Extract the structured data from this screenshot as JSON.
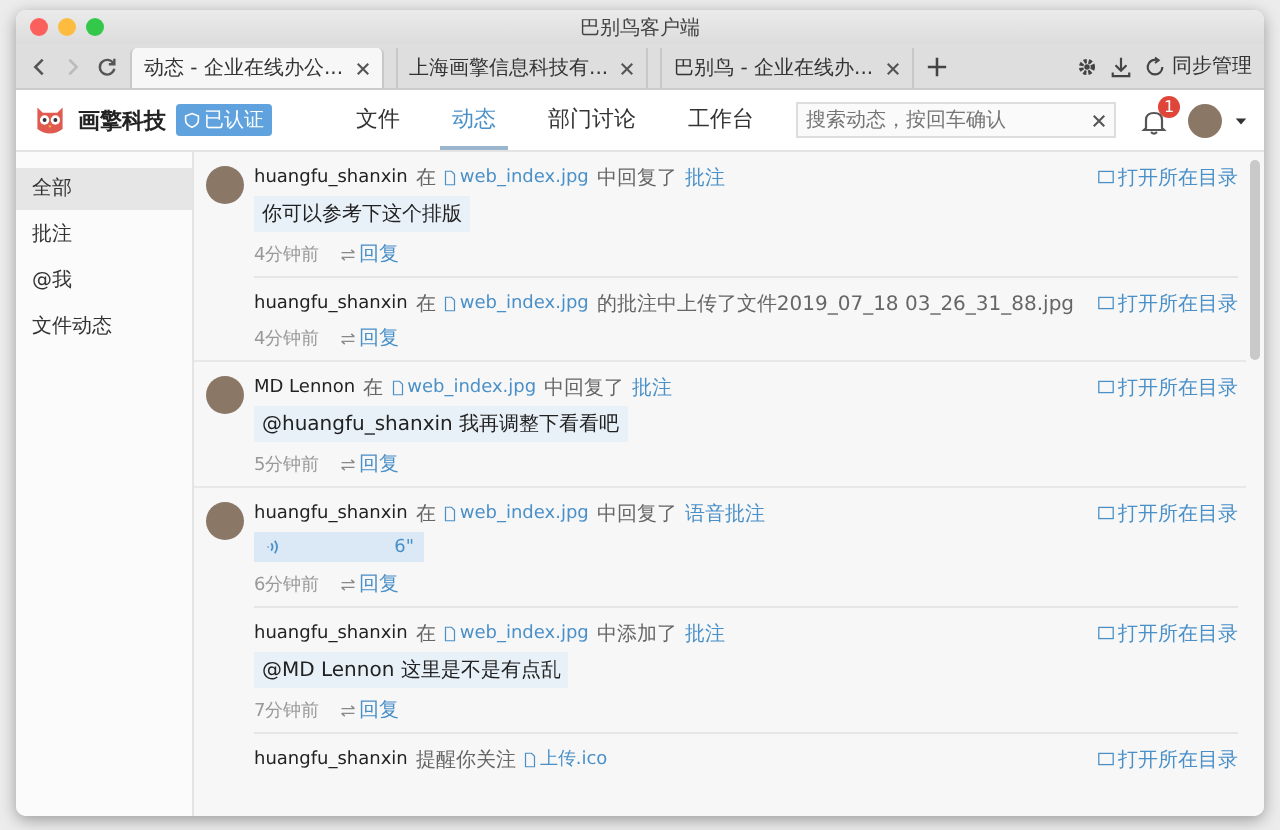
{
  "window": {
    "title": "巴别鸟客户端"
  },
  "browser_tabs": [
    {
      "label": "动态 - 企业在线办公...",
      "selected": true
    },
    {
      "label": "上海画擎信息科技有...",
      "selected": false
    },
    {
      "label": "巴别鸟 - 企业在线办...",
      "selected": false
    }
  ],
  "toolbar": {
    "sync_label": "同步管理"
  },
  "header": {
    "brand": "画擎科技",
    "badge": "已认证",
    "nav": [
      {
        "label": "文件",
        "selected": false
      },
      {
        "label": "动态",
        "selected": true
      },
      {
        "label": "部门讨论",
        "selected": false
      },
      {
        "label": "工作台",
        "selected": false
      }
    ],
    "search": {
      "placeholder": "搜索动态，按回车确认"
    },
    "notification_count": "1"
  },
  "sidebar": {
    "items": [
      {
        "label": "全部",
        "selected": true
      },
      {
        "label": "批注",
        "selected": false
      },
      {
        "label": "@我",
        "selected": false
      },
      {
        "label": "文件动态",
        "selected": false
      }
    ]
  },
  "feed": [
    {
      "kind": "comment",
      "avatar": true,
      "user": "huangfu_shanxin",
      "at": "在",
      "file": "web_index.jpg",
      "action": "中回复了",
      "target": "批注",
      "body": "你可以参考下这个排版",
      "time": "4分钟前",
      "reply": "回复",
      "open_dir": "打开所在目录"
    },
    {
      "kind": "upload",
      "avatar": false,
      "user": "huangfu_shanxin",
      "at": "在",
      "file": "web_index.jpg",
      "action": "的批注中上传了文件2019_07_18 03_26_31_88.jpg",
      "time": "4分钟前",
      "reply": "回复",
      "open_dir": "打开所在目录"
    },
    {
      "kind": "comment",
      "avatar": true,
      "user": "MD Lennon",
      "at": "在",
      "file": "web_index.jpg",
      "action": "中回复了",
      "target": "批注",
      "body": "@huangfu_shanxin 我再调整下看看吧",
      "time": "5分钟前",
      "reply": "回复",
      "open_dir": "打开所在目录"
    },
    {
      "kind": "voice",
      "avatar": true,
      "user": "huangfu_shanxin",
      "at": "在",
      "file": "web_index.jpg",
      "action": "中回复了",
      "target": "语音批注",
      "duration": "6\"",
      "time": "6分钟前",
      "reply": "回复",
      "open_dir": "打开所在目录"
    },
    {
      "kind": "comment",
      "avatar": false,
      "user": "huangfu_shanxin",
      "at": "在",
      "file": "web_index.jpg",
      "action": "中添加了",
      "target": "批注",
      "body": "@MD Lennon 这里是不是有点乱",
      "time": "7分钟前",
      "reply": "回复",
      "open_dir": "打开所在目录"
    },
    {
      "kind": "follow",
      "avatar": false,
      "user": "huangfu_shanxin",
      "action": "提醒你关注",
      "file": "上传.ico",
      "open_dir": "打开所在目录"
    }
  ]
}
